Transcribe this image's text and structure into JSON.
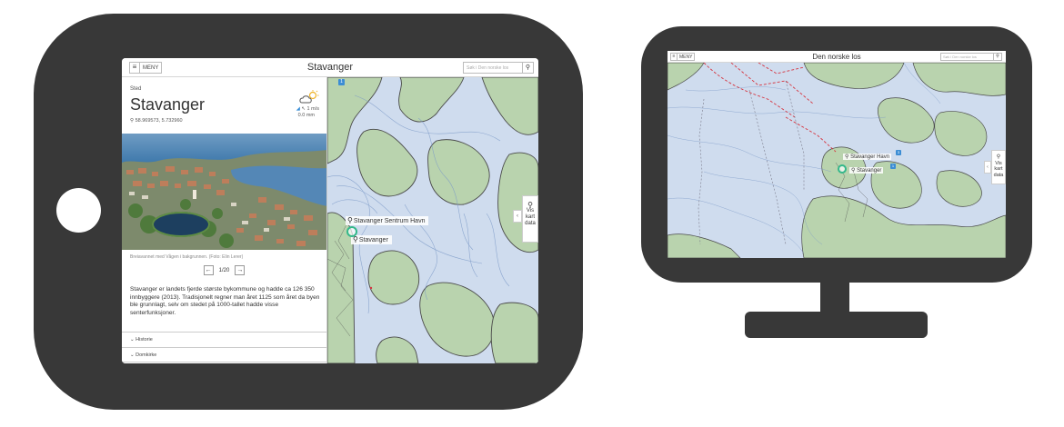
{
  "tablet": {
    "topbar": {
      "menu_icon": "hamburger-icon",
      "menu_label": "MENY",
      "title": "Stavanger",
      "search_placeholder": "Søk i Den norske los",
      "search_icon": "magnifier-icon"
    },
    "panel": {
      "close_icon": "close-icon",
      "kicker": "Sted",
      "name": "Stavanger",
      "coords": "58.969573, 5.732960",
      "weather": {
        "icon": "partly-cloudy-icon",
        "wind": "1 m/s",
        "precipitation": "0.0 mm"
      },
      "caption": "Breiavannet med Vågen i bakgrunnen. (Foto: Elin Lerer)",
      "pager": {
        "prev_icon": "arrow-left-icon",
        "next_icon": "arrow-right-icon",
        "count": "1/20"
      },
      "description": "Stavanger er landets fjerde største bykommune og hadde ca 126 350 innbyggere (2013). Tradisjonelt regner man året 1125 som året da byen ble grunnlagt, selv om stedet på 1000-tallet hadde visse senterfunksjoner.",
      "sections": [
        {
          "label": "Historie"
        },
        {
          "label": "Domkirke"
        }
      ]
    },
    "map": {
      "labels": [
        "Stavanger Sentrum Havn",
        "Stavanger"
      ],
      "side_tab": {
        "line1": "Vis",
        "line2": "kart",
        "line3": "data"
      },
      "badge": "1"
    }
  },
  "monitor": {
    "topbar": {
      "menu_label": "MENY",
      "title": "Den norske los",
      "search_placeholder": "Søk i Den norske los"
    },
    "map": {
      "labels": [
        "Stavanger Havn",
        "Stavanger"
      ],
      "side_tab": {
        "line1": "Vis",
        "line2": "kart",
        "line3": "data"
      },
      "badges": [
        "3",
        "1"
      ]
    }
  },
  "colors": {
    "device": "#383838",
    "water": "#cfdcee",
    "land": "#b9d3ae",
    "location_ring": "#33b88a",
    "badge": "#3c8dd4",
    "shipping_lane": "#d6343f"
  }
}
